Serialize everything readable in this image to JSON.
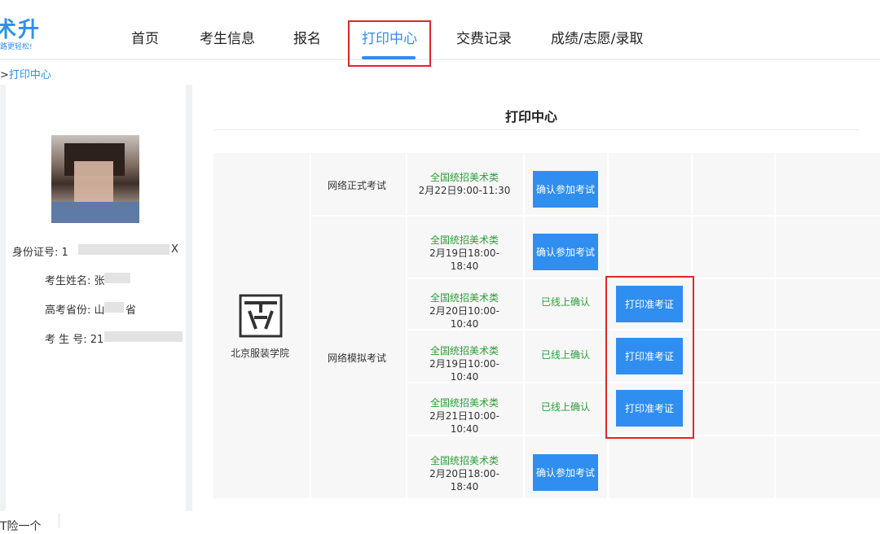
{
  "logo": {
    "main": "术升",
    "sub": "路更轻松!"
  },
  "nav": {
    "items": [
      "首页",
      "考生信息",
      "报名",
      "打印中心",
      "交费记录",
      "成绩/志愿/录取"
    ],
    "active_index": 3
  },
  "breadcrumb": {
    "sep": ">",
    "current": "打印中心"
  },
  "profile": {
    "id_label": "身份证号: 1",
    "id_tail": "X",
    "name_label": "考生姓名: 张",
    "province_label": "高考省份: 山",
    "province_tail": "省",
    "number_label": "考 生 号: 21"
  },
  "main": {
    "title": "打印中心"
  },
  "table": {
    "school": "北京服装学院",
    "formal_label": "网络正式考试",
    "mock_label": "网络模拟考试",
    "rows": [
      {
        "exam": "全国统招美术类",
        "time": "2月22日9:00-11:30",
        "action": "确认参加考试"
      },
      {
        "exam": "全国统招美术类",
        "time": "2月19日18:00-18:40",
        "action": "确认参加考试"
      },
      {
        "exam": "全国统招美术类",
        "time": "2月20日10:00-10:40",
        "status": "已线上确认",
        "print": "打印准考证"
      },
      {
        "exam": "全国统招美术类",
        "time": "2月19日10:00-10:40",
        "status": "已线上确认",
        "print": "打印准考证"
      },
      {
        "exam": "全国统招美术类",
        "time": "2月21日10:00-10:40",
        "status": "已线上确认",
        "print": "打印准考证"
      },
      {
        "exam": "全国统招美术类",
        "time": "2月20日18:00-18:40",
        "action": "确认参加考试"
      }
    ]
  },
  "footer": {
    "fragment": "T险一个"
  },
  "colors": {
    "accent": "#2f8ef0",
    "highlight": "#e0262b",
    "confirmed": "#2e9d3a"
  }
}
